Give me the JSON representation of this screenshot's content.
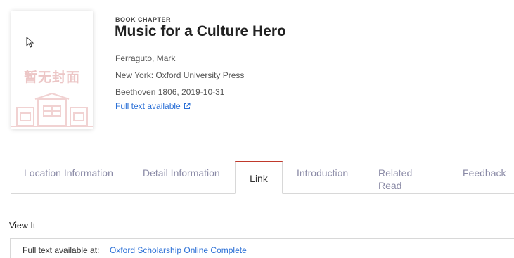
{
  "cover": {
    "placeholder_text": "暂无封面"
  },
  "record": {
    "type_label": "BOOK CHAPTER",
    "title": "Music for a Culture Hero",
    "author": "Ferraguto, Mark",
    "publisher": "New York: Oxford University Press",
    "series": "Beethoven 1806, 2019-10-31",
    "full_text_link": "Full text available"
  },
  "tabs": [
    {
      "label": "Location Information",
      "active": false
    },
    {
      "label": "Detail Information",
      "active": false
    },
    {
      "label": "Link",
      "active": true
    },
    {
      "label": "Introduction",
      "active": false
    },
    {
      "label": "Related Read",
      "active": false
    },
    {
      "label": "Feedback",
      "active": false
    }
  ],
  "view_it": {
    "section_title": "View It",
    "row_label": "Full text available at:",
    "row_value": "Oxford Scholarship Online Complete"
  },
  "colors": {
    "active_tab_accent": "#c0392b",
    "link": "#2a6fd6",
    "tab_inactive": "#8a8aa6"
  }
}
